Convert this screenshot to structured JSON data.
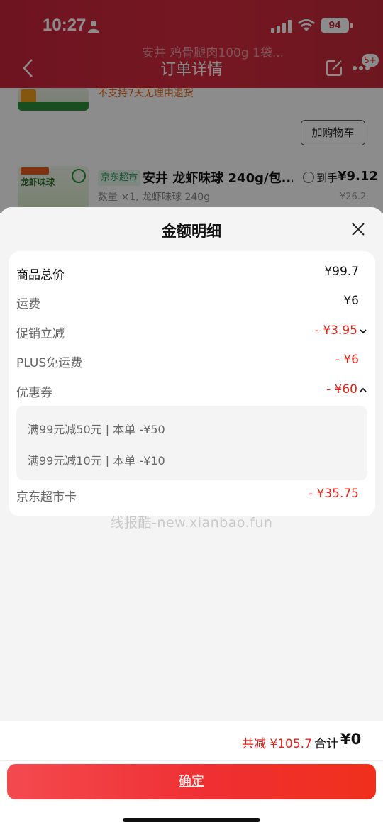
{
  "status_bar": {
    "time": "10:27",
    "battery": "94"
  },
  "nav": {
    "title": "订单详情",
    "ghost_title": "安井 鸡骨腿肉100g 1袋...",
    "badge": "5+"
  },
  "background_items": {
    "item1_notice": "不支持7天无理由退货",
    "add_to_cart": "加购物车",
    "item2": {
      "thumb_label": "龙虾味球",
      "store_badge": "京东超市",
      "name": "安井 龙虾味球 240g/包...",
      "hand_price_label": "到手",
      "hand_price": "¥9.12",
      "spec": "数量 ×1, 龙虾味球 240g",
      "original_price": "¥26.2"
    }
  },
  "sheet": {
    "title": "金额明细",
    "rows": [
      {
        "label": "商品总价",
        "value": "¥99.7"
      },
      {
        "label": "运费",
        "value": "¥6"
      },
      {
        "label": "促销立减",
        "value": "- ¥3.95"
      },
      {
        "label": "PLUS免运费",
        "value": "- ¥6"
      },
      {
        "label": "优惠券",
        "value": "- ¥60"
      },
      {
        "label": "京东超市卡",
        "value": "- ¥35.75"
      }
    ],
    "coupons": [
      "满99元减50元 | 本单 -¥50",
      "满99元减10元 | 本单 -¥10"
    ],
    "watermark": "线报酷-new.xianbao.fun"
  },
  "footer": {
    "total_reduce": "共减 ¥105.7",
    "total_label": "合计",
    "total_value": "¥0",
    "confirm": "确定"
  },
  "colors": {
    "accent_red": "#e2231a",
    "header_red": "#c8253b",
    "button_red": "#f0301c"
  }
}
